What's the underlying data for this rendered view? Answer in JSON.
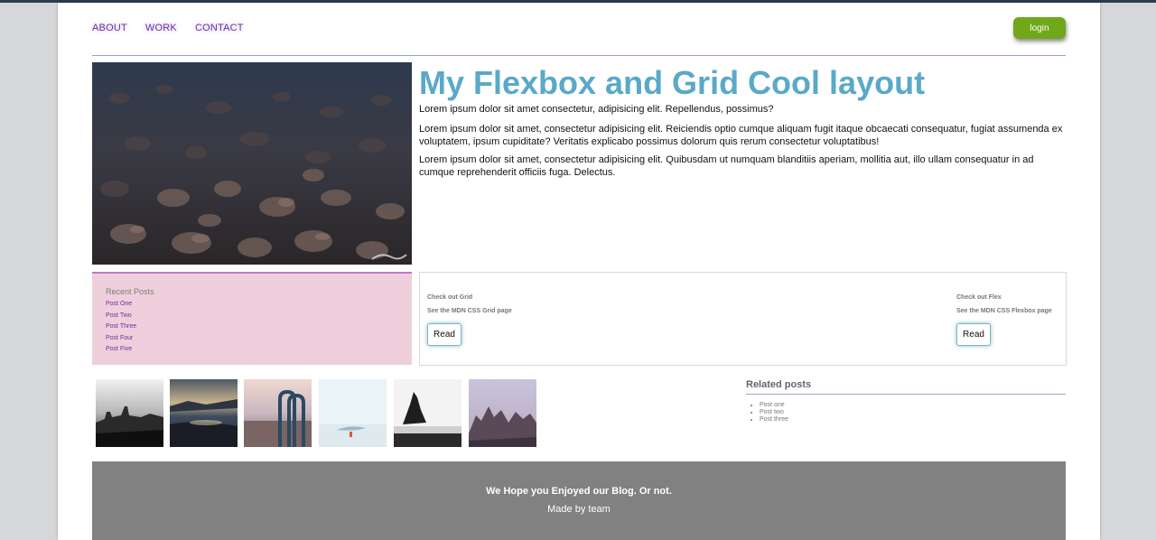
{
  "nav": {
    "items": [
      "ABOUT",
      "WORK",
      "CONTACT"
    ],
    "login_label": "login"
  },
  "hero": {
    "image": "rocky-water-photo",
    "title": "My Flexbox and Grid Cool layout",
    "paragraphs": [
      "Lorem ipsum dolor sit amet consectetur, adipisicing elit. Repellendus, possimus?",
      "Lorem ipsum dolor sit amet, consectetur adipisicing elit. Reiciendis optio cumque aliquam fugit itaque obcaecati consequatur, fugiat assumenda ex voluptatem, ipsum cupiditate? Veritatis explicabo possimus dolorum quis rerum consectetur voluptatibus!",
      "Lorem ipsum dolor sit amet, consectetur adipisicing elit. Quibusdam ut numquam blanditiis aperiam, mollitia aut, illo ullam consequatur in ad cumque reprehenderit officiis fuga. Delectus."
    ]
  },
  "recent_posts": {
    "title": "Recent Posts",
    "items": [
      "Post One",
      "Post Two",
      "Post Three",
      "Post Four",
      "Post Five"
    ]
  },
  "cards": [
    {
      "heading": "Check out Grid",
      "subtext": "See the MDN CSS Grid page",
      "button": "Read"
    },
    {
      "heading": "Check out Flex",
      "subtext": "See the MDN CSS Flexbox page",
      "button": "Read"
    }
  ],
  "gallery": [
    "city-fog-photo",
    "coast-sunset-photo",
    "pool-ladder-photo",
    "seagull-snow-photo",
    "sea-stack-photo",
    "mountain-peaks-photo"
  ],
  "related": {
    "title": "Related posts",
    "items": [
      "Post one",
      "Post two",
      "Post three"
    ]
  },
  "footer": {
    "line1": "We Hope you Enjoyed our Blog. Or not.",
    "line2": "Made by team"
  },
  "colors": {
    "accent_title": "#5aa9c8",
    "nav_link": "#6b2fa0",
    "login_bg": "#71a81a",
    "recent_bg": "#efcfdb",
    "footer_bg": "#818181"
  }
}
